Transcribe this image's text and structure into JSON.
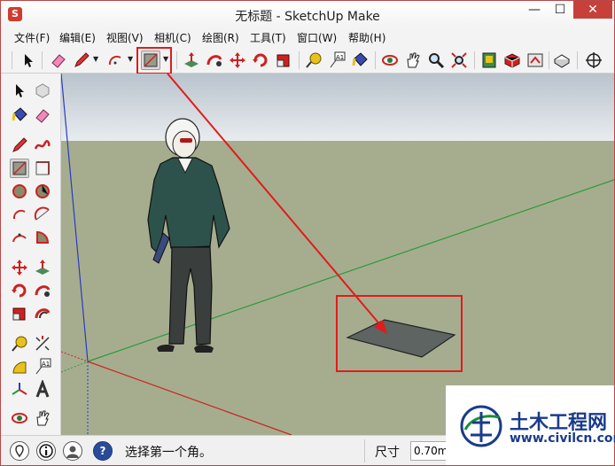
{
  "window": {
    "app_icon": "S",
    "title": "无标题 - SketchUp Make",
    "minimize": "—",
    "maximize": "☐",
    "close": "✕"
  },
  "menu": {
    "items": [
      "文件(F)",
      "编辑(E)",
      "视图(V)",
      "相机(C)",
      "绘图(R)",
      "工具(T)",
      "窗口(W)",
      "帮助(H)"
    ]
  },
  "toolbar": {
    "icons": [
      "select-arrow-icon",
      "eraser-icon",
      "pencil-icon",
      "arc-icon",
      "rectangle-icon",
      "push-pull-icon",
      "follow-me-icon",
      "move-icon",
      "rotate-icon",
      "scale-icon",
      "tape-measure-icon",
      "text-icon",
      "paint-bucket-icon",
      "orbit-icon",
      "pan-icon",
      "zoom-icon",
      "zoom-extents-icon",
      "warehouse-icon",
      "extension-icon",
      "share-icon",
      "components-icon",
      "position-camera-icon"
    ],
    "highlight_color": "#e21b1b"
  },
  "status": {
    "hint": "选择第一个角。",
    "measure_label": "尺寸",
    "measure_value": "0.70m,"
  },
  "watermark": {
    "title": "土木工程网",
    "url": "www.civilcn.com"
  },
  "colors": {
    "sky_top": "#b9c3cc",
    "sky_bottom": "#e8ecef",
    "ground": "#a6ad8f",
    "accent_red": "#e21b1b"
  }
}
